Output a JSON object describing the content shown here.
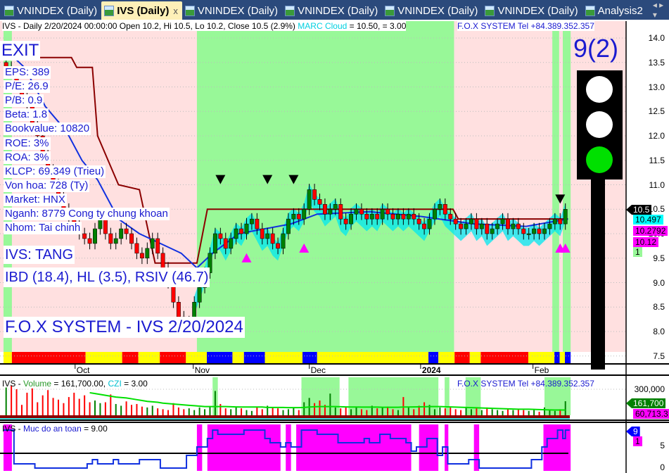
{
  "tabs": [
    {
      "label": "VNINDEX (Daily)"
    },
    {
      "label": "IVS (Daily)",
      "active": true,
      "close": "x"
    },
    {
      "label": "VNINDEX (Daily)"
    },
    {
      "label": "VNINDEX (Daily)"
    },
    {
      "label": "VNINDEX (Daily)"
    },
    {
      "label": "VNINDEX (Daily)"
    },
    {
      "label": "Analysis2"
    }
  ],
  "tab_scroll": "◂ ▸ ▾",
  "price_panel": {
    "header": "IVS - Daily 2/20/2024 00:00:00 Open 10.2, Hi 10.5, Lo 10.2, Close 10.5 (2.9%)",
    "marc_label": "MARC Cloud",
    "marc_value": " = 10.50,   = 3.00",
    "fox_tel": "F.O.X SYSTEM Tel +84.389.352.357",
    "exit": "EXIT",
    "fundamentals": [
      "EPS: 389",
      "P/E: 26.9",
      "P/B: 0.9",
      "Beta: 1.8",
      "Bookvalue: 10820",
      "ROE: 3%",
      "ROA: 3%",
      "KLCP: 69.349 (Trieu)",
      "Von hoa: 728 (Ty)",
      "Market: HNX",
      "Nganh: 8779 Cong ty chung khoan",
      "Nhom: Tai chinh"
    ],
    "trend": "IVS: TANG",
    "indicators": "IBD (18.4), HL (3.5), RSIV (46.7)",
    "watermark": "F.O.X SYSTEM - IVS 2/20/2024",
    "score": "9(2)",
    "y_ticks": [
      "14.0",
      "13.5",
      "13.0",
      "12.5",
      "12.0",
      "11.5",
      "11.0",
      "10.5",
      "10.0",
      "9.5",
      "9.0",
      "8.5",
      "8.0",
      "7.5"
    ],
    "tags": [
      {
        "text": "10.5",
        "color": "#000000",
        "fg": "#ffffff"
      },
      {
        "text": "10.497",
        "color": "#00ffff",
        "fg": "#000000"
      },
      {
        "text": "10.2792",
        "color": "#ff00ff",
        "fg": "#000000"
      },
      {
        "text": "10.12",
        "color": "#ff00ff",
        "fg": "#000000"
      },
      {
        "text": "1",
        "color": "#98f898",
        "fg": "#000000"
      }
    ],
    "months": [
      {
        "label": "Oct",
        "i": 13.7
      },
      {
        "label": "Nov",
        "i": 36.3
      },
      {
        "label": "Dec",
        "i": 58.5
      },
      {
        "label": "2024",
        "i": 79.8
      },
      {
        "label": "Feb",
        "i": 101.3
      }
    ]
  },
  "chart_data": {
    "type": "candlestick",
    "closes": [
      13.4,
      13.3,
      13.0,
      12.8,
      12.6,
      12.2,
      12.0,
      11.6,
      11.3,
      11.0,
      10.8,
      10.5,
      10.3,
      10.2,
      10.0,
      9.9,
      9.8,
      10.1,
      10.3,
      10.0,
      9.8,
      9.9,
      10.1,
      10.0,
      9.8,
      9.6,
      9.5,
      9.7,
      9.9,
      9.6,
      9.3,
      9.0,
      8.6,
      8.3,
      8.0,
      8.2,
      8.6,
      8.9,
      9.2,
      9.6,
      10.0,
      9.9,
      9.7,
      9.9,
      10.1,
      10.0,
      10.2,
      10.3,
      10.1,
      9.9,
      10.0,
      9.8,
      9.7,
      10.0,
      10.3,
      10.4,
      10.3,
      10.5,
      10.9,
      10.7,
      10.6,
      10.4,
      10.5,
      10.6,
      10.3,
      10.2,
      10.4,
      10.5,
      10.4,
      10.3,
      10.4,
      10.3,
      10.5,
      10.4,
      10.3,
      10.4,
      10.3,
      10.4,
      10.3,
      10.2,
      10.1,
      10.3,
      10.5,
      10.6,
      10.4,
      10.3,
      10.2,
      10.1,
      10.2,
      10.3,
      10.1,
      10.2,
      10.0,
      10.1,
      10.2,
      10.3,
      10.1,
      10.2,
      10.1,
      10.0,
      10.0,
      10.1,
      10.0,
      10.1,
      10.2,
      10.3,
      10.2,
      10.5
    ],
    "stop_line": [
      [
        6,
        13.6
      ],
      [
        13,
        13.6
      ],
      [
        14,
        13.4
      ],
      [
        17,
        13.4
      ],
      [
        18,
        12.0
      ],
      [
        22,
        11.0
      ],
      [
        26,
        10.9
      ],
      [
        29,
        9.4
      ],
      [
        37,
        9.4
      ],
      [
        39,
        10.5
      ],
      [
        86,
        10.5
      ],
      [
        87,
        10.3
      ],
      [
        108,
        10.3
      ]
    ],
    "trail_line": [
      [
        0,
        13.8
      ],
      [
        4,
        13.4
      ],
      [
        8,
        12.6
      ],
      [
        12,
        12.1
      ],
      [
        15,
        11.5
      ],
      [
        18,
        11.1
      ],
      [
        22,
        10.3
      ],
      [
        26,
        10.0
      ],
      [
        30,
        9.8
      ],
      [
        34,
        9.6
      ],
      [
        37,
        9.3
      ],
      [
        40,
        9.6
      ],
      [
        45,
        10.0
      ],
      [
        55,
        10.2
      ],
      [
        60,
        10.4
      ],
      [
        70,
        10.45
      ],
      [
        80,
        10.35
      ],
      [
        90,
        10.2
      ],
      [
        100,
        10.15
      ],
      [
        108,
        10.3
      ]
    ],
    "green_zones": [
      [
        0,
        1.6
      ],
      [
        37,
        86.2
      ],
      [
        105,
        106.3
      ],
      [
        107,
        108.5
      ]
    ],
    "strip": [
      [
        1.6,
        "#ffff00"
      ],
      [
        15.7,
        "#ff0000"
      ],
      [
        22.7,
        "#ffff00"
      ],
      [
        25.8,
        "#ff0000"
      ],
      [
        29.9,
        "#ffff00"
      ],
      [
        34.9,
        "#ff0000"
      ],
      [
        38.9,
        "#ffff00"
      ],
      [
        43.8,
        "#0000ff"
      ],
      [
        46,
        "#ffff00"
      ],
      [
        50,
        "#0000ff"
      ],
      [
        57.2,
        "#ffff00"
      ],
      [
        60,
        "#0000ff"
      ],
      [
        81.3,
        "#ffff00"
      ],
      [
        83.2,
        "#0000ff"
      ],
      [
        86.3,
        "#ffff00"
      ],
      [
        89.2,
        "#ff0000"
      ],
      [
        91.3,
        "#ffff00"
      ],
      [
        100.4,
        "#ff0000"
      ],
      [
        105.4,
        "#ffff00"
      ],
      [
        106.4,
        "#0000ff"
      ],
      [
        107.4,
        "#ffff00"
      ],
      [
        108.5,
        "#0000ff"
      ]
    ],
    "sell_signals": [
      [
        41,
        11.2
      ],
      [
        50,
        11.2
      ],
      [
        55,
        11.2
      ],
      [
        106,
        10.8
      ]
    ],
    "buy_signals": [
      [
        46,
        9.6
      ],
      [
        57,
        9.8
      ],
      [
        106,
        9.8
      ],
      [
        107,
        9.8
      ]
    ]
  },
  "volume_panel": {
    "title_prefix": "IVS - ",
    "vol_label": "Volume",
    "vol_value": " = 161,700.00, ",
    "czi_label": "CZI",
    "czi_value": " = 3.00",
    "fox_tel": "F.O.X SYSTEM Tel +84.389.352.357",
    "y_tick": "300,000",
    "tags": [
      {
        "text": "161,700",
        "color": "#008000",
        "fg": "#ffffff"
      },
      {
        "text": "60,713.3",
        "color": "#ff00ff",
        "fg": "#000000"
      }
    ],
    "volumes_k": [
      320,
      340,
      300,
      120,
      260,
      310,
      150,
      230,
      290,
      200,
      180,
      140,
      210,
      260,
      190,
      230,
      150,
      170,
      140,
      150,
      240,
      130,
      110,
      160,
      120,
      130,
      100,
      90,
      110,
      80,
      70,
      60,
      140,
      90,
      70,
      80,
      60,
      90,
      70,
      100,
      280,
      130,
      80,
      70,
      100,
      80,
      60,
      50,
      90,
      70,
      110,
      90,
      80,
      60,
      70,
      90,
      60,
      150,
      200,
      140,
      170,
      120,
      250,
      90,
      80,
      100,
      70,
      90,
      70,
      60,
      110,
      80,
      90,
      100,
      70,
      60,
      210,
      100,
      70,
      110,
      150,
      120,
      70,
      90,
      80,
      100,
      70,
      60,
      90,
      70,
      80,
      60,
      90,
      70,
      60,
      50,
      80,
      60,
      70,
      60,
      50,
      60,
      40,
      90,
      60,
      50,
      70,
      162
    ],
    "ma_k": [
      null,
      null,
      null,
      null,
      null,
      null,
      null,
      null,
      null,
      null,
      null,
      null,
      null,
      null,
      null,
      null,
      260,
      250,
      240,
      230,
      220,
      210,
      205,
      200,
      190,
      180,
      170,
      160,
      155,
      150,
      140,
      135,
      130,
      125,
      120,
      115,
      110,
      105,
      100,
      100,
      100,
      100,
      100,
      98,
      96,
      95,
      95,
      95,
      95,
      95,
      90,
      90,
      90,
      90,
      88,
      88,
      88,
      90,
      95,
      98,
      100,
      100,
      100,
      100,
      98,
      96,
      95,
      95,
      94,
      94,
      94,
      94,
      92,
      92,
      92,
      92,
      95,
      95,
      96,
      97,
      98,
      100,
      100,
      100,
      98,
      96,
      94,
      92,
      90,
      88,
      86,
      84,
      82,
      80,
      78,
      76,
      74,
      72,
      70,
      70,
      70,
      68,
      66,
      64,
      62,
      61,
      61,
      61
    ],
    "green_zones": [
      [
        40,
        41
      ],
      [
        57,
        64.3
      ],
      [
        66,
        83.2
      ],
      [
        84.4,
        85.3
      ],
      [
        88.4,
        91.3
      ],
      [
        103.5,
        108.5
      ]
    ]
  },
  "safety_panel": {
    "title_prefix": "IVS - ",
    "label": "Muc do an toan",
    "value": " = 9.00",
    "y_ticks": [
      "5",
      "0"
    ],
    "tags": [
      {
        "text": "9",
        "color": "#0000ff",
        "fg": "#ffffff"
      },
      {
        "text": "1",
        "color": "#ff00ff",
        "fg": "#000000"
      }
    ],
    "threshold": 3.5,
    "steps": [
      [
        0,
        9
      ],
      [
        2,
        1
      ],
      [
        6,
        0
      ],
      [
        16,
        1
      ],
      [
        17,
        2
      ],
      [
        18,
        1
      ],
      [
        21,
        2
      ],
      [
        22,
        1
      ],
      [
        26,
        2
      ],
      [
        30,
        0
      ],
      [
        35,
        3
      ],
      [
        37,
        5
      ],
      [
        39,
        7
      ],
      [
        40,
        9
      ],
      [
        41,
        8
      ],
      [
        46,
        9
      ],
      [
        50,
        7
      ],
      [
        51,
        6
      ],
      [
        53,
        5
      ],
      [
        54,
        6
      ],
      [
        55,
        5
      ],
      [
        57,
        9
      ],
      [
        60,
        8
      ],
      [
        64,
        6
      ],
      [
        69,
        7
      ],
      [
        70,
        6
      ],
      [
        72,
        8
      ],
      [
        74,
        7
      ],
      [
        77,
        6
      ],
      [
        78,
        4
      ],
      [
        79,
        5
      ],
      [
        81,
        7
      ],
      [
        83,
        3
      ],
      [
        84,
        5
      ],
      [
        85,
        1
      ],
      [
        89,
        2
      ],
      [
        91,
        0
      ],
      [
        101,
        2
      ],
      [
        103,
        5
      ],
      [
        104,
        7
      ],
      [
        106,
        9
      ],
      [
        107,
        7
      ],
      [
        107.5,
        9
      ],
      [
        108.3,
        9
      ]
    ],
    "safe_zones": [
      [
        0,
        1.6
      ],
      [
        37,
        38
      ],
      [
        39,
        53
      ],
      [
        54,
        55
      ],
      [
        56,
        78
      ],
      [
        79.5,
        83.2
      ],
      [
        84.4,
        85.1
      ],
      [
        90,
        91
      ],
      [
        103.3,
        108.5
      ]
    ]
  },
  "colors": {
    "bull": "#008000",
    "bear": "#ff0000",
    "bg_pink": "#ffe0e0",
    "bg_green": "#98f898",
    "accent_blue": "#1a1ad0"
  }
}
